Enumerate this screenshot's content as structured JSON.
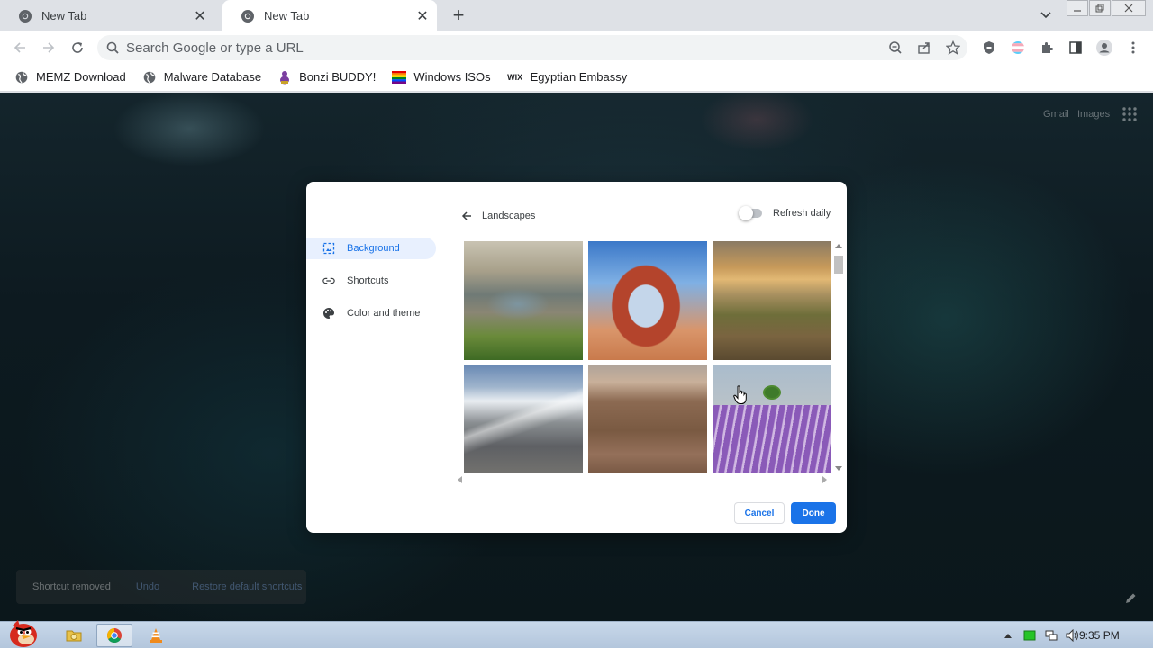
{
  "browser": {
    "tabs": [
      {
        "title": "New Tab",
        "active": false
      },
      {
        "title": "New Tab",
        "active": true
      }
    ],
    "omnibox": {
      "placeholder": "Search Google or type a URL",
      "value": ""
    },
    "bookmarks": [
      {
        "label": "MEMZ Download",
        "icon": "globe-icon"
      },
      {
        "label": "Malware Database",
        "icon": "globe-icon"
      },
      {
        "label": "Bonzi BUDDY!",
        "icon": "bonzi-icon"
      },
      {
        "label": "Windows ISOs",
        "icon": "rainbow-flag-icon"
      },
      {
        "label": "Egyptian Embassy",
        "icon": "wix-icon"
      }
    ],
    "wix_label": "WIX"
  },
  "ntp": {
    "gmail_link": "Gmail",
    "images_link": "Images",
    "toast": {
      "message": "Shortcut removed",
      "undo": "Undo",
      "restore": "Restore default shortcuts"
    }
  },
  "customize_dialog": {
    "nav": [
      {
        "label": "Background",
        "icon": "background-icon",
        "selected": true
      },
      {
        "label": "Shortcuts",
        "icon": "link-icon",
        "selected": false
      },
      {
        "label": "Color and theme",
        "icon": "palette-icon",
        "selected": false
      }
    ],
    "collection_title": "Landscapes",
    "refresh_daily_label": "Refresh daily",
    "refresh_daily_on": false,
    "images": [
      {
        "subject": "coastal-rocks"
      },
      {
        "subject": "delicate-arch"
      },
      {
        "subject": "canyon-plateau"
      },
      {
        "subject": "snowy-mountains"
      },
      {
        "subject": "desert-canyon"
      },
      {
        "subject": "lavender-field-tree"
      }
    ],
    "cancel_label": "Cancel",
    "done_label": "Done"
  },
  "taskbar": {
    "clock": "9:35 PM"
  },
  "colors": {
    "accent": "#1a73e8",
    "selected_nav_bg": "#e8f0fe"
  }
}
